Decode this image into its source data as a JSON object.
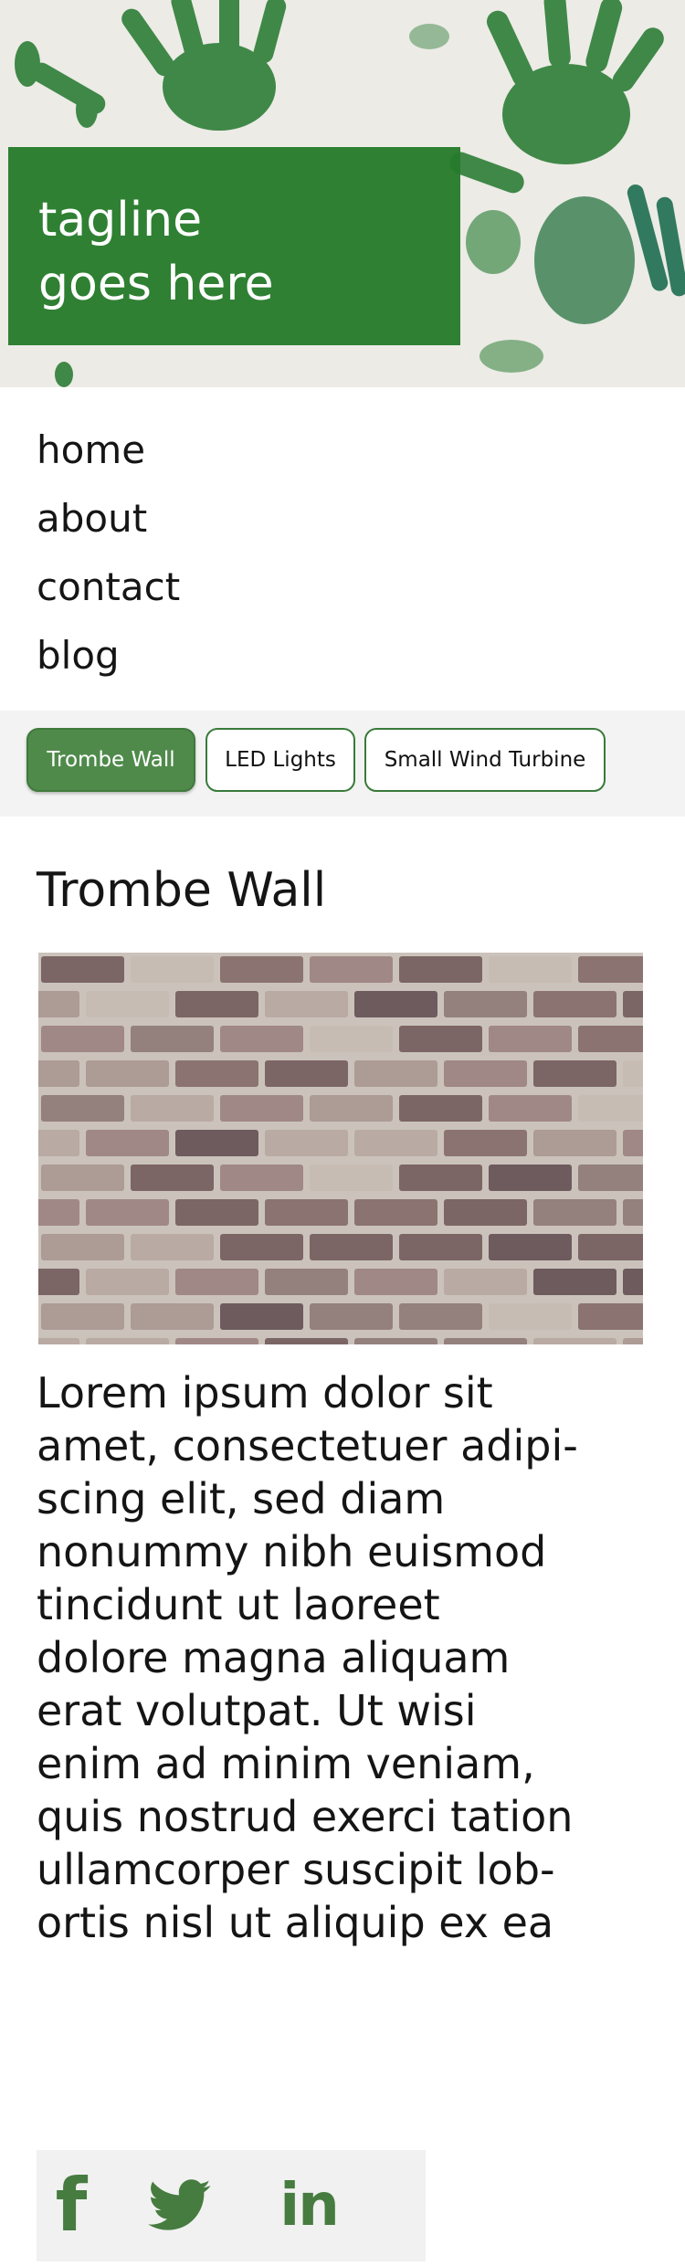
{
  "hero": {
    "tagline": "tagline\ngoes here"
  },
  "nav": {
    "items": [
      {
        "label": "home"
      },
      {
        "label": "about"
      },
      {
        "label": "contact"
      },
      {
        "label": "blog"
      }
    ]
  },
  "tabs": [
    {
      "label": "Trombe Wall",
      "active": true
    },
    {
      "label": "LED Lights",
      "active": false
    },
    {
      "label": "Small Wind Turbine",
      "active": false
    }
  ],
  "article": {
    "title": "Trombe Wall",
    "body": "Lorem ipsum dolor sit\namet, consectetuer adipi-\nscing elit, sed diam\nnonummy nibh euismod\ntincidunt ut laoreet\ndolore magna aliquam\nerat volutpat. Ut wisi\nenim ad minim veniam,\nquis nostrud exerci tation\nullamcorper suscipit lob-\nortis nisl ut aliquip ex ea"
  },
  "social": {
    "icons": [
      "facebook-icon",
      "twitter-icon",
      "linkedin-icon"
    ],
    "facebook_glyph": "f",
    "linkedin_glyph": "in"
  },
  "colors": {
    "brand_green": "#267b2c",
    "tab_active": "#4f8a4b",
    "tab_border": "#397a3a",
    "icon_green": "#467c3f"
  }
}
